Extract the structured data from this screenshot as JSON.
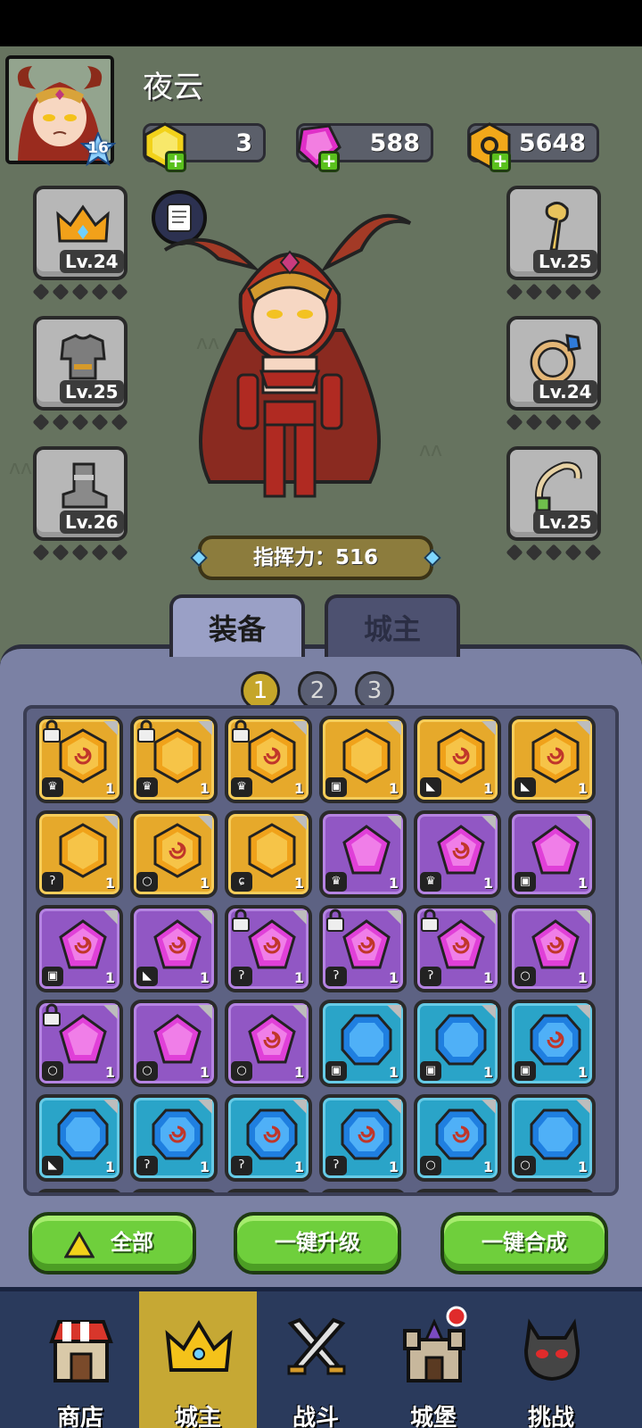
{
  "player": {
    "name": "夜云",
    "level": "16"
  },
  "currencies": [
    {
      "name": "gold-gem",
      "value": "3",
      "color": "#f2d21a"
    },
    {
      "name": "pink-gem",
      "value": "588",
      "color": "#e02fc8"
    },
    {
      "name": "coin",
      "value": "5648",
      "color": "#f2a81a"
    }
  ],
  "equipment": {
    "left": [
      {
        "item": "crown",
        "level": "Lv.24"
      },
      {
        "item": "armor",
        "level": "Lv.25"
      },
      {
        "item": "boot",
        "level": "Lv.26"
      }
    ],
    "right": [
      {
        "item": "staff",
        "level": "Lv.25"
      },
      {
        "item": "ring",
        "level": "Lv.24"
      },
      {
        "item": "necklace",
        "level": "Lv.25"
      }
    ]
  },
  "power": {
    "label": "指挥力：516"
  },
  "tabs": [
    {
      "label": "装备",
      "active": true
    },
    {
      "label": "城主",
      "active": false
    }
  ],
  "pages": [
    "1",
    "2",
    "3"
  ],
  "current_page": "1",
  "inventory": [
    {
      "tier": "gold",
      "locked": true,
      "swirl": true,
      "cat": "crown",
      "count": "1"
    },
    {
      "tier": "gold",
      "locked": true,
      "swirl": false,
      "cat": "crown",
      "count": "1"
    },
    {
      "tier": "gold",
      "locked": true,
      "swirl": true,
      "cat": "crown",
      "count": "1"
    },
    {
      "tier": "gold",
      "locked": false,
      "swirl": false,
      "cat": "armor",
      "count": "1"
    },
    {
      "tier": "gold",
      "locked": false,
      "swirl": true,
      "cat": "boot",
      "count": "1"
    },
    {
      "tier": "gold",
      "locked": false,
      "swirl": true,
      "cat": "boot",
      "count": "1"
    },
    {
      "tier": "gold",
      "locked": false,
      "swirl": false,
      "cat": "staff",
      "count": "1"
    },
    {
      "tier": "gold",
      "locked": false,
      "swirl": true,
      "cat": "ring",
      "count": "1"
    },
    {
      "tier": "gold",
      "locked": false,
      "swirl": false,
      "cat": "necklace",
      "count": "1"
    },
    {
      "tier": "purple",
      "locked": false,
      "swirl": false,
      "cat": "crown",
      "count": "1"
    },
    {
      "tier": "purple",
      "locked": false,
      "swirl": true,
      "cat": "crown",
      "count": "1"
    },
    {
      "tier": "purple",
      "locked": false,
      "swirl": false,
      "cat": "armor",
      "count": "1"
    },
    {
      "tier": "purple",
      "locked": false,
      "swirl": true,
      "cat": "armor",
      "count": "1"
    },
    {
      "tier": "purple",
      "locked": false,
      "swirl": true,
      "cat": "boot",
      "count": "1"
    },
    {
      "tier": "purple",
      "locked": true,
      "swirl": true,
      "cat": "staff",
      "count": "1"
    },
    {
      "tier": "purple",
      "locked": true,
      "swirl": true,
      "cat": "staff",
      "count": "1"
    },
    {
      "tier": "purple",
      "locked": true,
      "swirl": true,
      "cat": "staff",
      "count": "1"
    },
    {
      "tier": "purple",
      "locked": false,
      "swirl": true,
      "cat": "ring",
      "count": "1"
    },
    {
      "tier": "purple",
      "locked": true,
      "swirl": false,
      "cat": "ring",
      "count": "1"
    },
    {
      "tier": "purple",
      "locked": false,
      "swirl": false,
      "cat": "ring",
      "count": "1"
    },
    {
      "tier": "purple",
      "locked": false,
      "swirl": true,
      "cat": "ring",
      "count": "1"
    },
    {
      "tier": "blue",
      "locked": false,
      "swirl": false,
      "cat": "armor",
      "count": "1"
    },
    {
      "tier": "blue",
      "locked": false,
      "swirl": false,
      "cat": "armor",
      "count": "1"
    },
    {
      "tier": "blue",
      "locked": false,
      "swirl": true,
      "cat": "armor",
      "count": "1"
    },
    {
      "tier": "blue",
      "locked": false,
      "swirl": false,
      "cat": "boot",
      "count": "1"
    },
    {
      "tier": "blue",
      "locked": false,
      "swirl": true,
      "cat": "staff",
      "count": "1"
    },
    {
      "tier": "blue",
      "locked": false,
      "swirl": true,
      "cat": "staff",
      "count": "1"
    },
    {
      "tier": "blue",
      "locked": false,
      "swirl": true,
      "cat": "staff",
      "count": "1"
    },
    {
      "tier": "blue",
      "locked": false,
      "swirl": true,
      "cat": "ring",
      "count": "1"
    },
    {
      "tier": "blue",
      "locked": false,
      "swirl": false,
      "cat": "ring",
      "count": "1"
    }
  ],
  "actions": {
    "all": "全部",
    "upgrade": "一键升级",
    "merge": "一键合成"
  },
  "nav": [
    {
      "label": "商店",
      "icon": "shop-icon",
      "active": false
    },
    {
      "label": "城主",
      "icon": "crown-icon",
      "active": true
    },
    {
      "label": "战斗",
      "icon": "swords-icon",
      "active": false
    },
    {
      "label": "城堡",
      "icon": "castle-icon",
      "active": false,
      "badge": true
    },
    {
      "label": "挑战",
      "icon": "demon-icon",
      "active": false
    }
  ]
}
